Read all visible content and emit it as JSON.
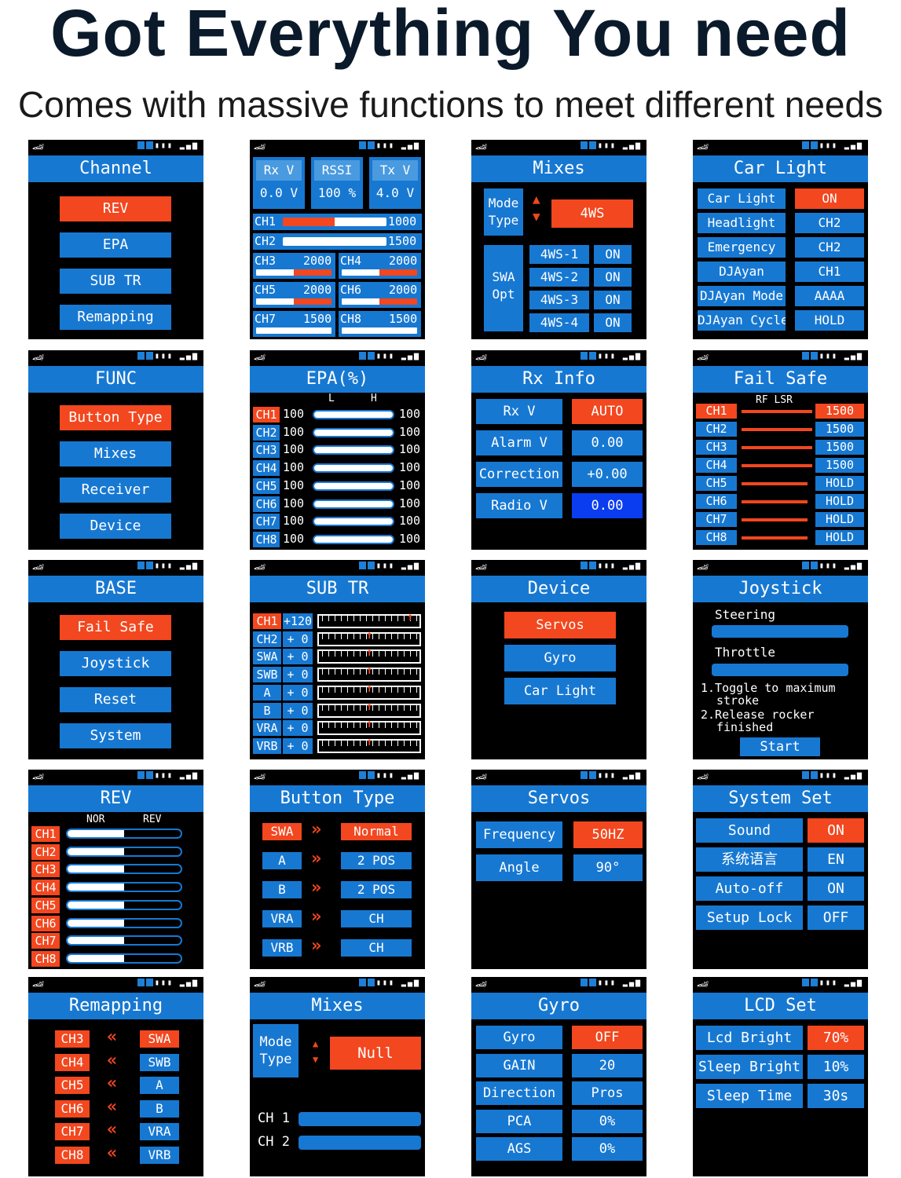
{
  "title": "Got Everything You need",
  "subtitle": "Comes with massive functions to meet different needs",
  "icons": {
    "car": "car-icon",
    "status": "status-icons"
  },
  "colors": {
    "blue": "#1778d2",
    "red": "#f2471f",
    "dark_blue": "#0a3cf0"
  },
  "channel": {
    "header": "Channel",
    "items": [
      "REV",
      "EPA",
      "SUB TR",
      "Remapping"
    ]
  },
  "monitor": {
    "rx_v_label": "Rx V",
    "rx_v": "0.0 V",
    "rssi_label": "RSSI",
    "rssi": "100 %",
    "tx_v_label": "Tx V",
    "tx_v": "4.0 V",
    "rows": [
      {
        "ch": "CH1",
        "val": "1000"
      },
      {
        "ch": "CH2",
        "val": "1500"
      }
    ],
    "pairs": [
      {
        "a": "CH3",
        "av": "2000",
        "b": "CH4",
        "bv": "2000"
      },
      {
        "a": "CH5",
        "av": "2000",
        "b": "CH6",
        "bv": "2000"
      },
      {
        "a": "CH7",
        "av": "1500",
        "b": "CH8",
        "bv": "1500"
      }
    ]
  },
  "mixes1": {
    "header": "Mixes",
    "mode": "Mode Type",
    "mode_value": "4WS",
    "swa": "SWA Opt",
    "rows": [
      {
        "k": "4WS-1",
        "v": "ON"
      },
      {
        "k": "4WS-2",
        "v": "ON"
      },
      {
        "k": "4WS-3",
        "v": "ON"
      },
      {
        "k": "4WS-4",
        "v": "ON"
      }
    ]
  },
  "carlight": {
    "header": "Car Light",
    "rows": [
      {
        "k": "Car Light",
        "v": "ON"
      },
      {
        "k": "Headlight",
        "v": "CH2"
      },
      {
        "k": "Emergency",
        "v": "CH2"
      },
      {
        "k": "DJAyan",
        "v": "CH1"
      },
      {
        "k": "DJAyan Mode",
        "v": "AAAA"
      },
      {
        "k": "DJAyan Cycle",
        "v": "HOLD"
      }
    ]
  },
  "func": {
    "header": "FUNC",
    "items": [
      "Button Type",
      "Mixes",
      "Receiver",
      "Device"
    ]
  },
  "epa": {
    "header": "EPA(%)",
    "l": "L",
    "h": "H",
    "rows": [
      {
        "ch": "CH1",
        "l": "100",
        "h": "100"
      },
      {
        "ch": "CH2",
        "l": "100",
        "h": "100"
      },
      {
        "ch": "CH3",
        "l": "100",
        "h": "100"
      },
      {
        "ch": "CH4",
        "l": "100",
        "h": "100"
      },
      {
        "ch": "CH5",
        "l": "100",
        "h": "100"
      },
      {
        "ch": "CH6",
        "l": "100",
        "h": "100"
      },
      {
        "ch": "CH7",
        "l": "100",
        "h": "100"
      },
      {
        "ch": "CH8",
        "l": "100",
        "h": "100"
      }
    ]
  },
  "rxinfo": {
    "header": "Rx Info",
    "rows": [
      {
        "k": "Rx V",
        "v": "AUTO"
      },
      {
        "k": "Alarm V",
        "v": "0.00"
      },
      {
        "k": "Correction",
        "v": "+0.00"
      },
      {
        "k": "Radio V",
        "v": "0.00"
      }
    ]
  },
  "failsafe": {
    "header": "Fail Safe",
    "rf": "RF LSR",
    "rows": [
      {
        "ch": "CH1",
        "v": "1500"
      },
      {
        "ch": "CH2",
        "v": "1500"
      },
      {
        "ch": "CH3",
        "v": "1500"
      },
      {
        "ch": "CH4",
        "v": "1500"
      },
      {
        "ch": "CH5",
        "v": "HOLD"
      },
      {
        "ch": "CH6",
        "v": "HOLD"
      },
      {
        "ch": "CH7",
        "v": "HOLD"
      },
      {
        "ch": "CH8",
        "v": "HOLD"
      }
    ]
  },
  "base": {
    "header": "BASE",
    "items": [
      "Fail Safe",
      "Joystick",
      "Reset",
      "System"
    ]
  },
  "subtr": {
    "header": "SUB TR",
    "rows": [
      {
        "ch": "CH1",
        "v": "+120"
      },
      {
        "ch": "CH2",
        "v": "+ 0"
      },
      {
        "ch": "SWA",
        "v": "+ 0"
      },
      {
        "ch": "SWB",
        "v": "+ 0"
      },
      {
        "ch": "A",
        "v": "+ 0"
      },
      {
        "ch": "B",
        "v": "+ 0"
      },
      {
        "ch": "VRA",
        "v": "+ 0"
      },
      {
        "ch": "VRB",
        "v": "+ 0"
      }
    ]
  },
  "device": {
    "header": "Device",
    "items": [
      "Servos",
      "Gyro",
      "Car Light"
    ]
  },
  "joystick": {
    "header": "Joystick",
    "steering": "Steering",
    "throttle": "Throttle",
    "note1": "1.Toggle to maximum",
    "note1b": "stroke",
    "note2": "2.Release rocker",
    "note2b": "finished",
    "start": "Start"
  },
  "rev": {
    "header": "REV",
    "nor": "NOR",
    "rev": "REV",
    "rows": [
      "CH1",
      "CH2",
      "CH3",
      "CH4",
      "CH5",
      "CH6",
      "CH7",
      "CH8"
    ]
  },
  "buttontype": {
    "header": "Button Type",
    "rows": [
      {
        "k": "SWA",
        "v": "Normal"
      },
      {
        "k": "A",
        "v": "2 POS"
      },
      {
        "k": "B",
        "v": "2 POS"
      },
      {
        "k": "VRA",
        "v": "CH"
      },
      {
        "k": "VRB",
        "v": "CH"
      }
    ]
  },
  "servos": {
    "header": "Servos",
    "rows": [
      {
        "k": "Frequency",
        "v": "50HZ"
      },
      {
        "k": "Angle",
        "v": "90°"
      }
    ]
  },
  "systemset": {
    "header": "System Set",
    "rows": [
      {
        "k": "Sound",
        "v": "ON"
      },
      {
        "k": "系统语言",
        "v": "EN"
      },
      {
        "k": "Auto-off",
        "v": "ON"
      },
      {
        "k": "Setup Lock",
        "v": "OFF"
      }
    ]
  },
  "remapping": {
    "header": "Remapping",
    "rows": [
      {
        "ch": "CH3",
        "v": "SWA"
      },
      {
        "ch": "CH4",
        "v": "SWB"
      },
      {
        "ch": "CH5",
        "v": "A"
      },
      {
        "ch": "CH6",
        "v": "B"
      },
      {
        "ch": "CH7",
        "v": "VRA"
      },
      {
        "ch": "CH8",
        "v": "VRB"
      }
    ]
  },
  "mixes2": {
    "header": "Mixes",
    "mode": "Mode Type",
    "mode_value": "Null",
    "ch1": "CH 1",
    "ch2": "CH 2"
  },
  "gyro": {
    "header": "Gyro",
    "rows": [
      {
        "k": "Gyro",
        "v": "OFF"
      },
      {
        "k": "GAIN",
        "v": "20"
      },
      {
        "k": "Direction",
        "v": "Pros"
      },
      {
        "k": "PCA",
        "v": "0%"
      },
      {
        "k": "AGS",
        "v": "0%"
      }
    ]
  },
  "lcdset": {
    "header": "LCD Set",
    "rows": [
      {
        "k": "Lcd Bright",
        "v": "70%"
      },
      {
        "k": "Sleep Bright",
        "v": "10%"
      },
      {
        "k": "Sleep Time",
        "v": "30s"
      }
    ]
  }
}
